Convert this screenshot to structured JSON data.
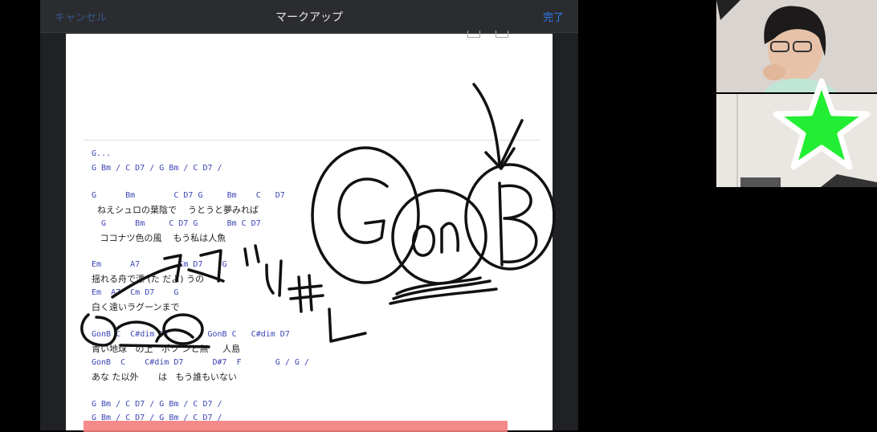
{
  "navbar": {
    "cancel_label": "キャンセル",
    "title": "マークアップ",
    "done_label": "完了"
  },
  "sheet": {
    "lines": [
      {
        "kind": "chord",
        "text": "G..."
      },
      {
        "kind": "chord",
        "text": "G Bm / C D7 / G Bm / C D7 /"
      },
      {
        "kind": "chord",
        "text": "G      Bm        C D7 G     Bm    C   D7"
      },
      {
        "kind": "lyric",
        "text": "  ねえシュロの葉陰で    うとうと夢みれば"
      },
      {
        "kind": "chord",
        "text": "  G      Bm     C D7 G      Bm C D7"
      },
      {
        "kind": "lyric",
        "text": "   ココナツ色の風    もう私は人魚"
      },
      {
        "kind": "chord",
        "text": "Em      A7        Cm D7    G"
      },
      {
        "kind": "lyric",
        "text": "揺れる舟で漂 (た だよ) うの"
      },
      {
        "kind": "chord",
        "text": "Em  A7  Cm D7    G"
      },
      {
        "kind": "lyric",
        "text": "白く遠いラグーンまで"
      },
      {
        "kind": "chord",
        "text": "GonB C  C#dim D7        GonB C   C#dim D7"
      },
      {
        "kind": "lyric",
        "text": "青い地球   の上   ポツ ンと無     人島"
      },
      {
        "kind": "chord",
        "text": "GonB  C    C#dim D7      D#7  F       G / G /"
      },
      {
        "kind": "lyric",
        "text": "あな た以外       は   もう誰もいない"
      },
      {
        "kind": "chord",
        "text": "G Bm / C D7 / G Bm / C D7 /"
      },
      {
        "kind": "chord",
        "text": "G Bm / C D7 / G Bm / C D7 /"
      }
    ]
  },
  "handwriting": {
    "circled_text": "GonB",
    "katakana_note": "ドド#",
    "bracket_note": "L"
  },
  "colors": {
    "accent_green": "#22ee33",
    "highlight": "#f47d7d",
    "chord_blue": "#3b45b5",
    "link_blue": "#2f7cf5"
  }
}
